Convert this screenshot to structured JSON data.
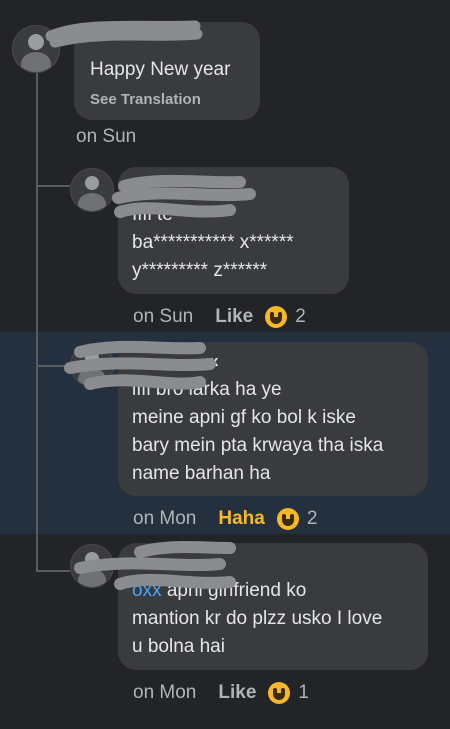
{
  "comments": [
    {
      "author": "",
      "text": "Happy New year",
      "see_translation": "See Translation",
      "time": "on Sun",
      "like_label": "",
      "reaction_count": ""
    },
    {
      "author": "",
      "text": "Iffi te******\nba*********** x******\ny********* z******",
      "time": "on Sun",
      "like_label": "Like",
      "reaction_count": "2"
    },
    {
      "author": "x",
      "text": "iffi bro larka ha ye\nmeine apni gf ko bol k iske\nbary mein pta krwaya tha iska\nname barhan ha",
      "time": "on Mon",
      "like_label": "Haha",
      "reaction_count": "2"
    },
    {
      "author": "",
      "mention": "oxx",
      "text": " apni girlfriend ko\nmantion kr do plzz usko I love\nu bolna hai",
      "time": "on Mon",
      "like_label": "Like",
      "reaction_count": "1"
    }
  ],
  "colors": {
    "background": "#232427",
    "highlight": "#24303e",
    "bubble": "#3a3b3c",
    "haha": "#f7b928",
    "mention": "#4da3ff"
  },
  "icons": [
    "avatar",
    "haha-reaction-icon"
  ]
}
